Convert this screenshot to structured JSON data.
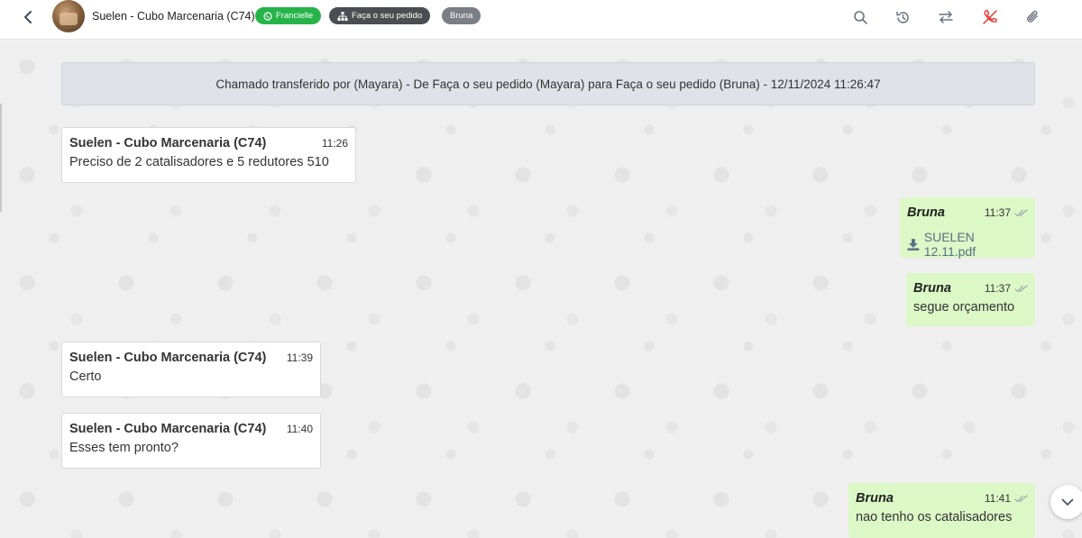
{
  "header": {
    "contact_name": "Suelen - Cubo Marcenaria (C74)",
    "tags": [
      {
        "label": "Francielle",
        "icon": "whatsapp-icon",
        "color": "#25b34a"
      },
      {
        "label": "Faça o seu pedido",
        "icon": "sitemap-icon",
        "color": "#4a4d52"
      },
      {
        "label": "Bruna",
        "color": "#7a7e85"
      }
    ],
    "tools": [
      "search-icon",
      "history-icon",
      "transfer-icon",
      "phone-off-icon",
      "paperclip-icon"
    ]
  },
  "system_message": "Chamado transferido por (Mayara) - De Faça o seu pedido (Mayara) para Faça o seu pedido (Bruna) - 12/11/2024 11:26:47",
  "messages": [
    {
      "direction": "in",
      "sender": "Suelen - Cubo Marcenaria (C74)",
      "time": "11:26",
      "text": "Preciso de 2 catalisadores e 5 redutores 510"
    },
    {
      "direction": "out",
      "sender": "Bruna",
      "time": "11:37",
      "attachment": "SUELEN 12.11.pdf"
    },
    {
      "direction": "out",
      "sender": "Bruna",
      "time": "11:37",
      "text": "segue orçamento"
    },
    {
      "direction": "in",
      "sender": "Suelen - Cubo Marcenaria (C74)",
      "time": "11:39",
      "text": "Certo"
    },
    {
      "direction": "in",
      "sender": "Suelen - Cubo Marcenaria (C74)",
      "time": "11:40",
      "text": "Esses tem pronto?"
    },
    {
      "direction": "out",
      "sender": "Bruna",
      "time": "11:41",
      "text": "nao tenho os catalisadores"
    }
  ],
  "colors": {
    "outgoing_bubble": "#dcf8c6",
    "incoming_bubble": "#ffffff",
    "chat_background": "#efefef",
    "hangup_red": "#e53935"
  }
}
